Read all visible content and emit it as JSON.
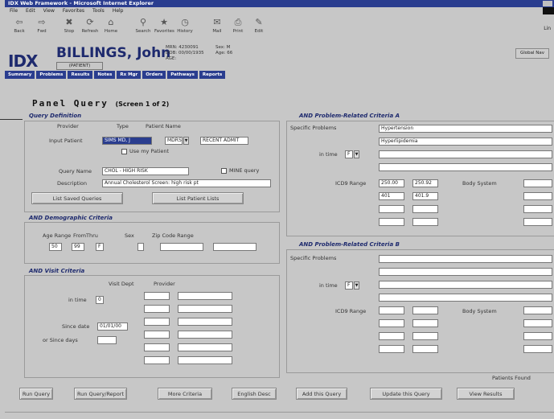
{
  "window": {
    "title": "IDX Web Framework - Microsoft Internet Explorer"
  },
  "menu": [
    "File",
    "Edit",
    "View",
    "Favorites",
    "Tools",
    "Help"
  ],
  "toolbar": {
    "buttons": [
      {
        "label": "Back",
        "icon": "back-arrow-icon",
        "glyph": "⇦"
      },
      {
        "label": "Fwd",
        "icon": "forward-arrow-icon",
        "glyph": "⇨"
      },
      {
        "label": "Stop",
        "icon": "stop-icon",
        "glyph": "✖"
      },
      {
        "label": "Refresh",
        "icon": "refresh-icon",
        "glyph": "⟳"
      },
      {
        "label": "Home",
        "icon": "home-icon",
        "glyph": "⌂"
      },
      {
        "label": "Search",
        "icon": "search-icon",
        "glyph": "⚲"
      },
      {
        "label": "Favorites",
        "icon": "favorites-icon",
        "glyph": "★"
      },
      {
        "label": "History",
        "icon": "history-icon",
        "glyph": "◷"
      },
      {
        "label": "Mail",
        "icon": "mail-icon",
        "glyph": "✉"
      },
      {
        "label": "Print",
        "icon": "print-icon",
        "glyph": "⎙"
      },
      {
        "label": "Edit",
        "icon": "edit-icon",
        "glyph": "✎"
      }
    ],
    "right_label": "Lin"
  },
  "patient": {
    "logo": "IDX",
    "name": "BILLINGS, John",
    "button": "(PATIENT)",
    "info_col1": [
      "MRN: 4230091",
      "DOB: 00/00/1935",
      "AGE:"
    ],
    "info_col2": [
      "Sex: M",
      "Age: 66"
    ],
    "global_button": "Global Nav"
  },
  "navtabs": [
    "Summary",
    "Problems",
    "Results",
    "Notes",
    "Rx Mgr",
    "Orders",
    "Pathways",
    "Reports"
  ],
  "page": {
    "title": "Panel Query",
    "subtitle": "(Screen 1 of 2)"
  },
  "query_def": {
    "section_title": "Query Definition",
    "col_headers": [
      "Provider",
      "Type",
      "Patient Name"
    ],
    "input_patient_label": "Input Patient",
    "provider_value": "SIMS MD, J",
    "type_value": "MDRS",
    "patient_name_value": "RECENT ADMIT",
    "use_my_patients_label": "Use my Patient",
    "query_name_label": "Query Name",
    "query_name_value": "CHOL - HIGH RISK",
    "mine_only_label": "MINE query",
    "description_label": "Description",
    "description_value": "Annual Cholesterol Screen: high risk pt",
    "list_saved_button": "List Saved Queries",
    "list_patient_button": "List Patient Lists"
  },
  "demographic": {
    "section_title": "AND Demographic Criteria",
    "headers": [
      "Age Range",
      "From",
      "Thru",
      "Sex",
      "Zip Code Range"
    ],
    "age_from": "50",
    "age_thru": "99",
    "sex": "F"
  },
  "visit": {
    "section_title": "AND Visit Criteria",
    "headers": [
      "Visit Dept",
      "Provider"
    ],
    "in_time_label": "in time",
    "in_time_value": "0",
    "since_date_label": "Since date",
    "since_date_value": "01/01/00",
    "since_days_label": "or Since days"
  },
  "problem_a": {
    "section_title": "AND Problem-Related Criteria A",
    "specific_label": "Specific Problems",
    "problems": [
      "Hypertension",
      "Hyperlipidemia",
      "",
      "",
      ""
    ],
    "in_time_label": "in time",
    "in_time_value": "F",
    "icd_label": "ICD9 Range",
    "icd_rows": [
      [
        "250.00",
        "250.92"
      ],
      [
        "401",
        "401.9"
      ],
      [
        "",
        ""
      ],
      [
        "",
        ""
      ]
    ],
    "body_system_label": "Body System"
  },
  "problem_b": {
    "section_title": "AND Problem-Related Criteria B",
    "specific_label": "Specific Problems",
    "in_time_label": "in time",
    "in_time_value": "F",
    "icd_label": "ICD9 Range",
    "body_system_label": "Body System"
  },
  "patients_found_label": "Patients Found",
  "bottom_buttons": [
    "Run Query",
    "Run Query/Report",
    "More Criteria",
    "English Desc",
    "Add this Query",
    "Update this Query",
    "View Results"
  ]
}
